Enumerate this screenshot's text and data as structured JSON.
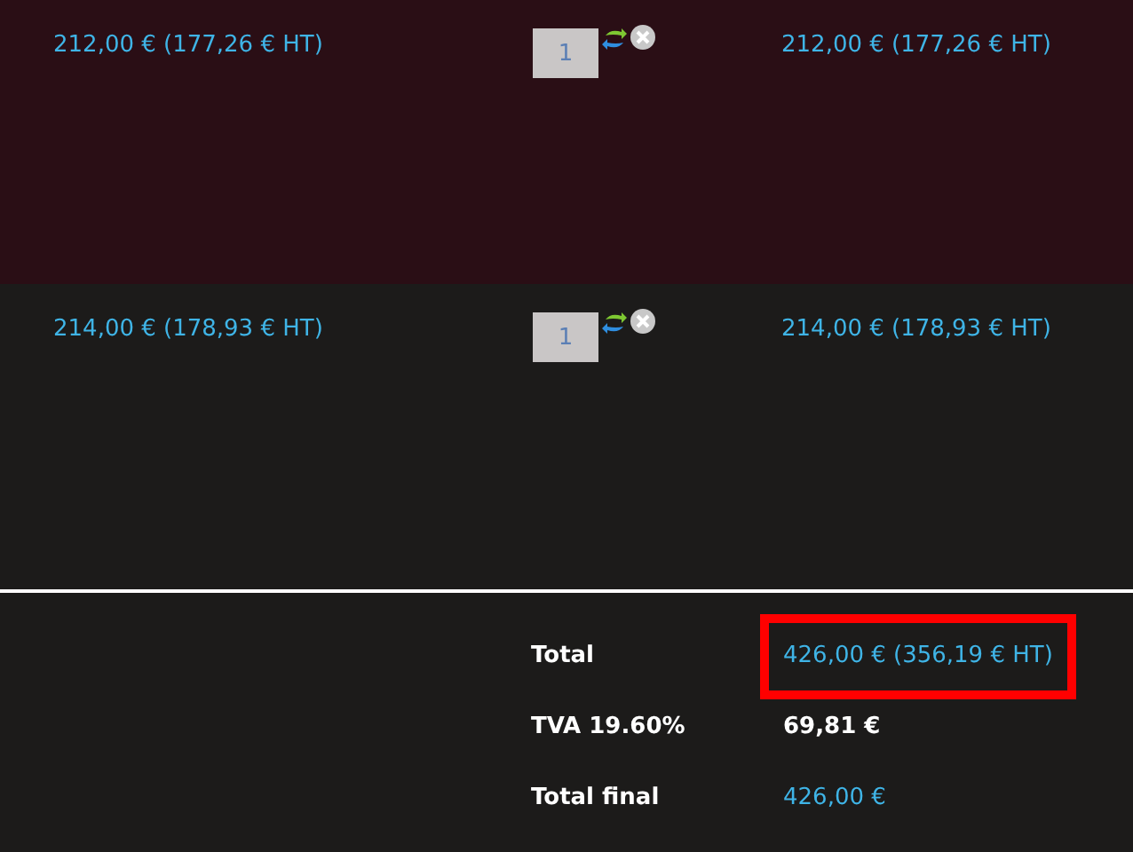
{
  "cart_rows": [
    {
      "unit_price": "212,00 € (177,26 € HT)",
      "quantity": "1",
      "line_total": "212,00 € (177,26 € HT)",
      "highlighted": true
    },
    {
      "unit_price": "214,00 € (178,93 € HT)",
      "quantity": "1",
      "line_total": "214,00 € (178,93 € HT)",
      "highlighted": false
    }
  ],
  "totals": [
    {
      "label": "Total",
      "value": "426,00 € (356,19 € HT)",
      "kind": "price",
      "highlighted": true
    },
    {
      "label": "TVA 19.60%",
      "value": "69,81 €",
      "kind": "tax",
      "highlighted": false
    },
    {
      "label": "Total final",
      "value": "426,00 €",
      "kind": "price",
      "highlighted": false
    }
  ]
}
